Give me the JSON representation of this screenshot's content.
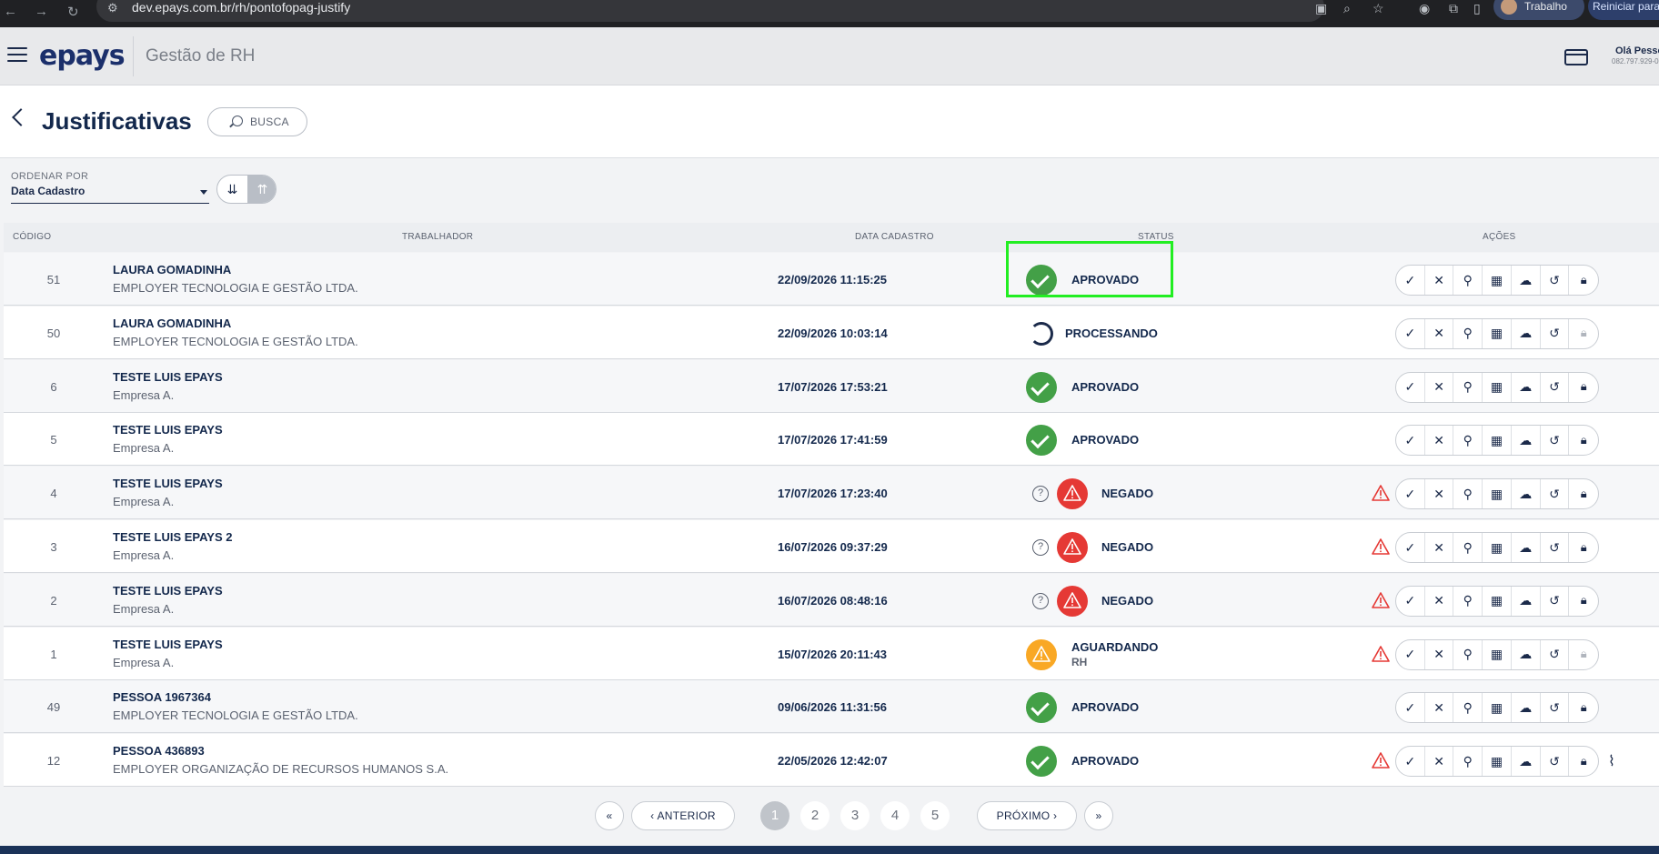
{
  "browser": {
    "url": "dev.epays.com.br/rh/pontofopag-justify",
    "profile": "Trabalho",
    "restart": "Reiniciar para"
  },
  "header": {
    "logo": "epays",
    "subtitle": "Gestão de RH",
    "greeting": "Olá Pesso",
    "greeting_sub": "082.797.929-0"
  },
  "page": {
    "title": "Justificativas",
    "search_label": "BUSCA"
  },
  "sort": {
    "label": "ORDENAR POR",
    "value": "Data Cadastro"
  },
  "table": {
    "headers": {
      "code": "CÓDIGO",
      "worker": "TRABALHADOR",
      "date": "DATA CADASTRO",
      "status": "STATUS",
      "actions": "AÇÕES"
    },
    "rows": [
      {
        "code": "51",
        "name": "LAURA GOMADINHA",
        "company": "EMPLOYER TECNOLOGIA E GESTÃO LTDA.",
        "date": "22/09/2026 11:15:25",
        "status": "APROVADO",
        "status_sub": "",
        "kind": "ok",
        "question": false,
        "alert": false,
        "lock_dim": false,
        "clip": false
      },
      {
        "code": "50",
        "name": "LAURA GOMADINHA",
        "company": "EMPLOYER TECNOLOGIA E GESTÃO LTDA.",
        "date": "22/09/2026 10:03:14",
        "status": "PROCESSANDO",
        "status_sub": "",
        "kind": "spin",
        "question": false,
        "alert": false,
        "lock_dim": true,
        "clip": false
      },
      {
        "code": "6",
        "name": "TESTE LUIS EPAYS",
        "company": "Empresa A.",
        "date": "17/07/2026 17:53:21",
        "status": "APROVADO",
        "status_sub": "",
        "kind": "ok",
        "question": false,
        "alert": false,
        "lock_dim": false,
        "clip": false
      },
      {
        "code": "5",
        "name": "TESTE LUIS EPAYS",
        "company": "Empresa A.",
        "date": "17/07/2026 17:41:59",
        "status": "APROVADO",
        "status_sub": "",
        "kind": "ok",
        "question": false,
        "alert": false,
        "lock_dim": false,
        "clip": false
      },
      {
        "code": "4",
        "name": "TESTE LUIS EPAYS",
        "company": "Empresa A.",
        "date": "17/07/2026 17:23:40",
        "status": "NEGADO",
        "status_sub": "",
        "kind": "err",
        "question": true,
        "alert": true,
        "lock_dim": false,
        "clip": false
      },
      {
        "code": "3",
        "name": "TESTE LUIS EPAYS 2",
        "company": "Empresa A.",
        "date": "16/07/2026 09:37:29",
        "status": "NEGADO",
        "status_sub": "",
        "kind": "err",
        "question": true,
        "alert": true,
        "lock_dim": false,
        "clip": false
      },
      {
        "code": "2",
        "name": "TESTE LUIS EPAYS",
        "company": "Empresa A.",
        "date": "16/07/2026 08:48:16",
        "status": "NEGADO",
        "status_sub": "",
        "kind": "err",
        "question": true,
        "alert": true,
        "lock_dim": false,
        "clip": false
      },
      {
        "code": "1",
        "name": "TESTE LUIS EPAYS",
        "company": "Empresa A.",
        "date": "15/07/2026 20:11:43",
        "status": "AGUARDANDO",
        "status_sub": "RH",
        "kind": "warn",
        "question": false,
        "alert": true,
        "lock_dim": true,
        "clip": false
      },
      {
        "code": "49",
        "name": "PESSOA 1967364",
        "company": "EMPLOYER TECNOLOGIA E GESTÃO LTDA.",
        "date": "09/06/2026 11:31:56",
        "status": "APROVADO",
        "status_sub": "",
        "kind": "ok",
        "question": false,
        "alert": false,
        "lock_dim": false,
        "clip": false
      },
      {
        "code": "12",
        "name": "PESSOA 436893",
        "company": "EMPLOYER ORGANIZAÇÃO DE RECURSOS HUMANOS S.A.",
        "date": "22/05/2026 12:42:07",
        "status": "APROVADO",
        "status_sub": "",
        "kind": "ok",
        "question": false,
        "alert": true,
        "lock_dim": false,
        "clip": true
      }
    ],
    "action_icons": [
      "check-icon",
      "close-icon",
      "search-icon",
      "building-icon",
      "cloud-download-icon",
      "history-icon",
      "lock-icon"
    ]
  },
  "pagination": {
    "prev": "ANTERIOR",
    "next": "PRÓXIMO",
    "pages": [
      "1",
      "2",
      "3",
      "4",
      "5"
    ],
    "current": "1"
  },
  "colors": {
    "approved": "#43a047",
    "denied": "#e53935",
    "waiting": "#f9a825",
    "highlight": "#22ee22"
  }
}
